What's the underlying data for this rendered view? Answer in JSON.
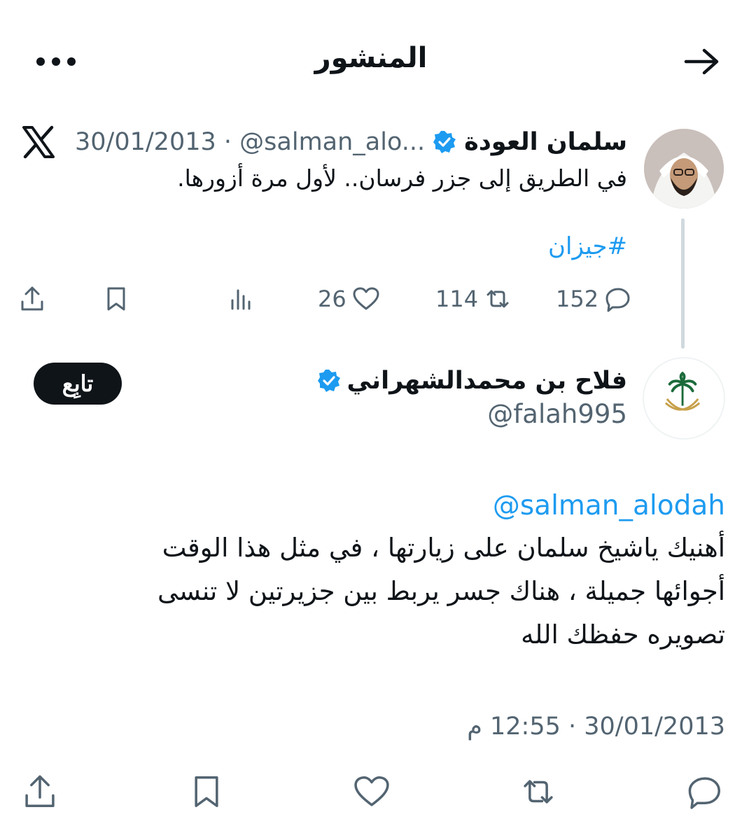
{
  "header": {
    "title": "المنشور",
    "back_icon": "arrow-right-icon",
    "more_icon": "more-horizontal-icon"
  },
  "parent_tweet": {
    "author_name": "سلمان العودة",
    "verified": true,
    "handle": "@salman_alo...",
    "date": "30/01/2013",
    "separator": "·",
    "source_icon": "x-logo-icon",
    "text": "في الطريق إلى جزر فرسان.. لأول مرة أزورها.",
    "hashtag": "#جيزان",
    "replies": "152",
    "reposts": "114",
    "likes": "26"
  },
  "main_tweet": {
    "author_name": "فلاح بن محمدالشهراني",
    "verified": true,
    "handle": "@falah995",
    "follow_label": "تابِع",
    "mention": "@salman_alodah",
    "text_lines": [
      "أهنيك ياشيخ سلمان على زيارتها ، في مثل هذا الوقت",
      "أجوائها جميلة ، هناك جسر يربط بين جزيرتين لا تنسى",
      "تصويره حفظك الله"
    ],
    "timestamp": "30/01/2013 · 12:55 م"
  },
  "colors": {
    "text": "#0f1419",
    "secondary": "#536471",
    "accent": "#1d9bf0",
    "follow_button": "#0f1419",
    "thread_line": "#cfd9de"
  }
}
